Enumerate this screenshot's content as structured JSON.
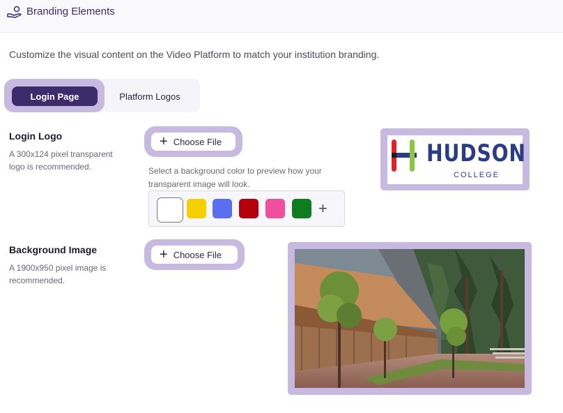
{
  "header": {
    "title": "Branding Elements",
    "icon": "hand-coin-icon"
  },
  "description": "Customize the visual content on the Video Platform to match your institution branding.",
  "tabs": [
    {
      "label": "Login Page",
      "active": true
    },
    {
      "label": "Platform Logos",
      "active": false
    }
  ],
  "login_logo": {
    "title": "Login Logo",
    "hint": "A 300x124 pixel transparent logo is recommended.",
    "choose_label": "Choose File",
    "bg_hint": "Select a background color to preview how your transparent image will look.",
    "swatches": [
      "#ffffff",
      "#f5cf00",
      "#5b6ef0",
      "#b3000c",
      "#ef4f9c",
      "#0f7c1f"
    ],
    "selected_swatch": "#ffffff",
    "preview": {
      "name": "HUDSON",
      "sub": "COLLEGE",
      "brand_color": "#2a3c87"
    }
  },
  "background_image": {
    "title": "Background Image",
    "hint": "A 1900x950 pixel image is recommended.",
    "choose_label": "Choose File"
  },
  "colors": {
    "accent": "#3d2b6b",
    "ring": "#c7b9e0"
  }
}
